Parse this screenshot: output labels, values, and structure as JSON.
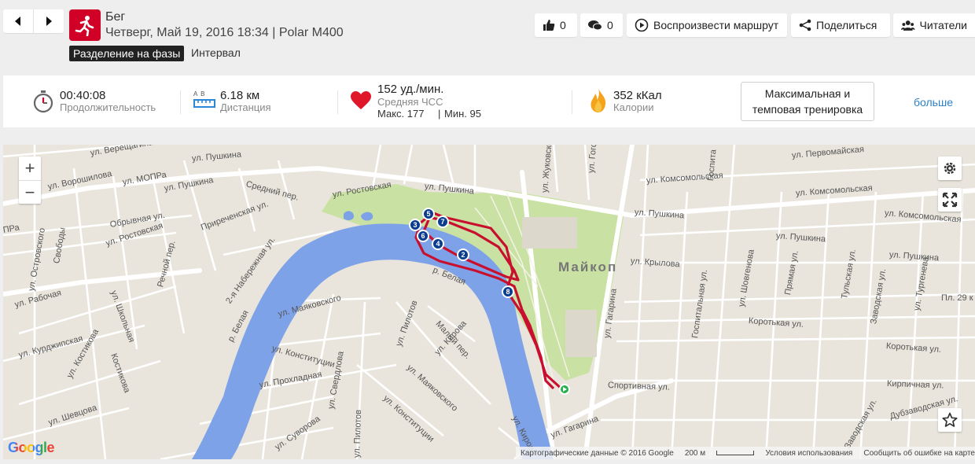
{
  "header": {
    "sport": "Бег",
    "meta": "Четверг, Май 19, 2016 18:34 | Polar M400",
    "phase_badge": "Разделение на фазы",
    "phase_type": "Интервал",
    "likes": "0",
    "comments": "0",
    "replay": "Воспроизвести маршрут",
    "share": "Поделиться",
    "followers": "Читатели"
  },
  "stats": {
    "duration": "00:40:08",
    "duration_label": "Продолжительность",
    "distance": "6.18 км",
    "distance_label": "Дистанция",
    "distance_icon_letters": "A  B",
    "hr": "152 уд./мин.",
    "hr_label": "Средняя ЧСС",
    "hr_max": "Макс. 177",
    "hr_min": "Мин. 95",
    "calories": "352 кКал",
    "calories_label": "Калории",
    "training_button": "Максимальная и темповая тренировка",
    "more": "больше"
  },
  "map": {
    "city": "Майкоп",
    "streets": [
      "ул. Верещагина",
      "ул. Ворошилова",
      "ул. МОПРа",
      "ул. Пушкина",
      "Средний пер.",
      "ул. Ростовская",
      "ул. Пушкина",
      "ул. Пушкина",
      "ул. Комсомольская",
      "ул. Первомайская",
      "ул. Комсомольская",
      "ул. Комсомольская",
      "ул. Пушкина",
      "ул. Пушкина",
      "ул. Пушкина",
      "ул. Крылова",
      "ул. Шовгенова",
      "ул. Гагарина",
      "Госпитальная ул.",
      "Прямая ул.",
      "Тульская ул.",
      "Заводская ул.",
      "ул. Тургенева",
      "Коротькая ул.",
      "Коротькая ул.",
      "Спортивная ул.",
      "ул. Гагарина",
      "Кирпичная ул.",
      "Дубзаводская ул.",
      "Заводская ул.",
      "ПРа",
      "ул. Островского",
      "Свободы",
      "ул. Ростовская",
      "Обрывная ул.",
      "Приреченская ул.",
      "Речной пер.",
      "ул. Школьная",
      "ул. Рабочая",
      "2-я Набережная ул.",
      "р. Белая",
      "р. Белая",
      "ул. Маяковского",
      "ул. Пилотов",
      "Малый пер.",
      "ул. Кирова",
      "ул. Конституции",
      "ул. Маяковского",
      "ул. Курджипская",
      "ул. Костикова",
      "ул. Прохладная",
      "ул. Свердлова",
      "ул. Конституции",
      "ул. Шевцова",
      "ул. Суворова",
      "ул. Пилотов",
      "ул. Кирова",
      "Костикова",
      "ул. Жуковского",
      "ул. Гоголя",
      "Госпита",
      "Пл. 29 к"
    ],
    "km_markers": [
      "2",
      "3",
      "4",
      "5",
      "6",
      "7",
      "8"
    ],
    "google": "Google",
    "footer_data": "Картографические данные © 2016 Google",
    "footer_scale": "200 м",
    "footer_terms": "Условия использования",
    "footer_report": "Сообщить об ошибке на карте",
    "route_color": "#c8102e",
    "water_color": "#7ea2e8",
    "park_color": "#c9e1a2"
  },
  "colors": {
    "accent": "#d10027",
    "link": "#2b80c8"
  }
}
